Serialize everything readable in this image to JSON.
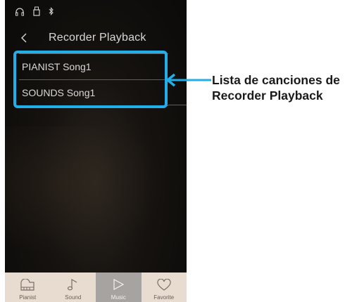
{
  "status_icons": [
    "headphones-icon",
    "usb-icon",
    "bluetooth-icon"
  ],
  "header": {
    "back_icon": "chevron-left-icon",
    "title": "Recorder Playback"
  },
  "list": {
    "items": [
      "PIANIST Song1",
      "SOUNDS Song1"
    ]
  },
  "callout": {
    "line1": "Lista de canciones de",
    "line2": "Recorder Playback",
    "color": "#22aee8"
  },
  "tabs": [
    {
      "label": "Pianist",
      "icon": "piano-icon",
      "active": false
    },
    {
      "label": "Sound",
      "icon": "music-note-icon",
      "active": false
    },
    {
      "label": "Music",
      "icon": "play-icon",
      "active": true
    },
    {
      "label": "Favorite",
      "icon": "heart-icon",
      "active": false
    }
  ]
}
